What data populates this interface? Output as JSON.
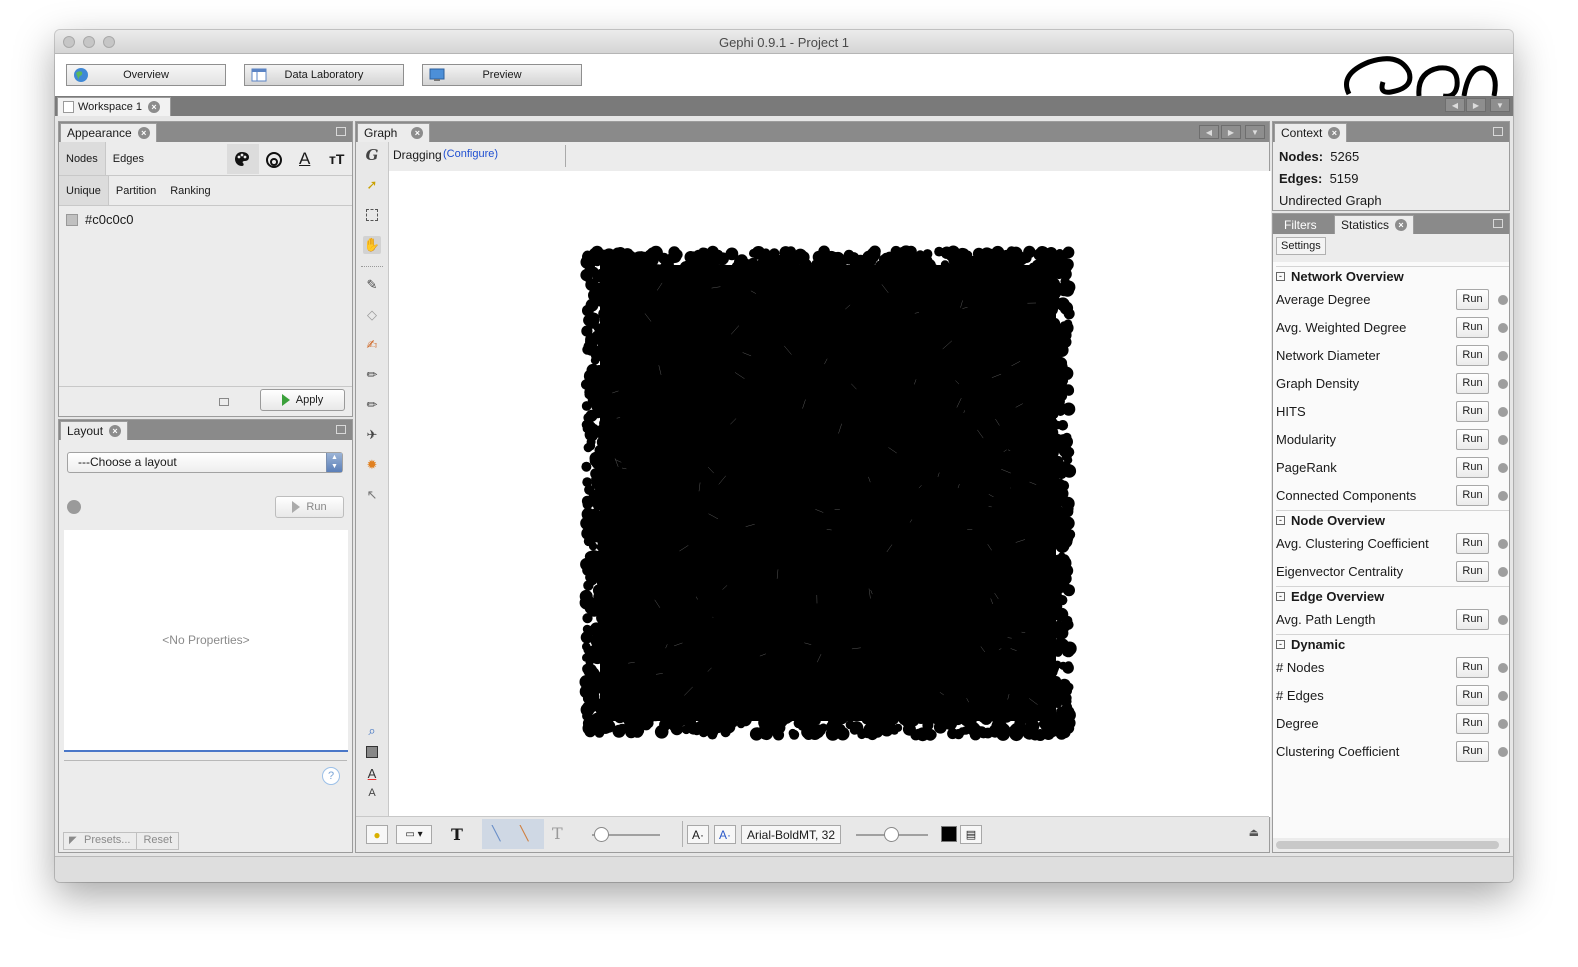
{
  "window": {
    "title": "Gephi 0.9.1 - Project 1"
  },
  "modes": [
    {
      "label": "Overview"
    },
    {
      "label": "Data Laboratory"
    },
    {
      "label": "Preview"
    }
  ],
  "workspace": {
    "tab_label": "Workspace 1"
  },
  "appearance": {
    "title": "Appearance",
    "element_tabs": [
      "Nodes",
      "Edges"
    ],
    "mode_tabs": [
      "Unique",
      "Partition",
      "Ranking"
    ],
    "color_value": "#c0c0c0",
    "apply_label": "Apply"
  },
  "layout": {
    "title": "Layout",
    "select_value": "---Choose a layout",
    "run_label": "Run",
    "no_properties": "<No Properties>",
    "presets_label": "Presets...",
    "reset_label": "Reset",
    "help_symbol": "?"
  },
  "graph": {
    "title": "Graph",
    "tool_label": "Dragging",
    "configure_label": "(Configure)",
    "font_label": "Arial-BoldMT, 32",
    "label_font_a": "A·",
    "label_size_a": "A·",
    "node_color": "#000000"
  },
  "context": {
    "title": "Context",
    "nodes_label": "Nodes:",
    "nodes_value": "5265",
    "edges_label": "Edges:",
    "edges_value": "5159",
    "graph_type": "Undirected Graph"
  },
  "statistics": {
    "tabs": [
      "Filters",
      "Statistics"
    ],
    "settings_label": "Settings",
    "run_label": "Run",
    "sections": [
      {
        "title": "Network Overview",
        "items": [
          "Average Degree",
          "Avg. Weighted Degree",
          "Network Diameter",
          "Graph Density",
          "HITS",
          "Modularity",
          "PageRank",
          "Connected Components"
        ]
      },
      {
        "title": "Node Overview",
        "items": [
          "Avg. Clustering Coefficient",
          "Eigenvector Centrality"
        ]
      },
      {
        "title": "Edge Overview",
        "items": [
          "Avg. Path Length"
        ]
      },
      {
        "title": "Dynamic",
        "items": [
          "# Nodes",
          "# Edges",
          "Degree",
          "Clustering Coefficient"
        ]
      }
    ]
  }
}
